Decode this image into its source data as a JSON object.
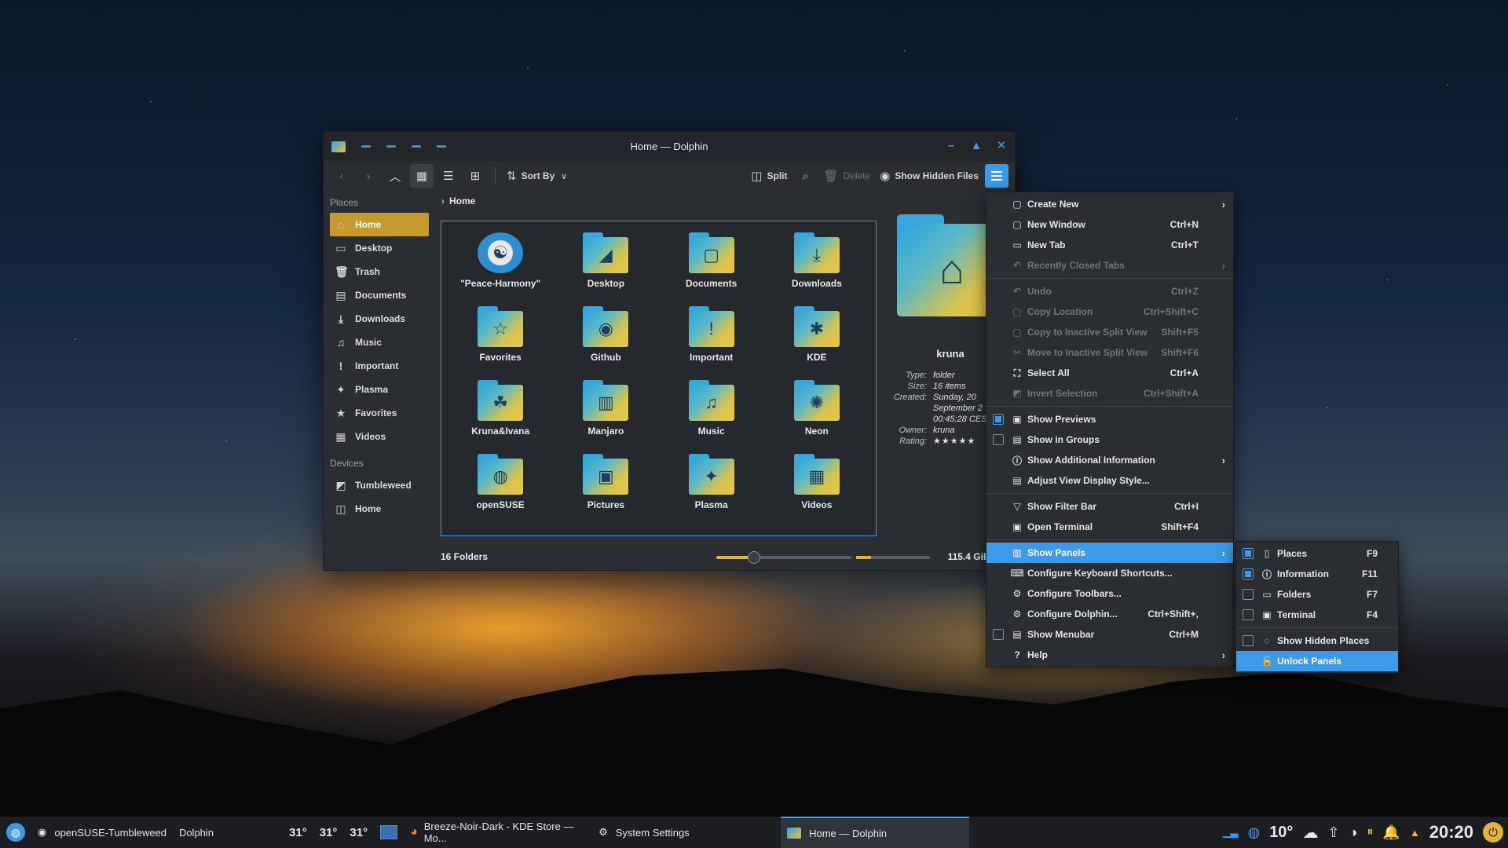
{
  "window": {
    "title": "Home — Dolphin",
    "min": "–",
    "max": "▲",
    "close": "✕"
  },
  "toolbar": {
    "sort_by": "Sort By",
    "split": "Split",
    "delete": "Delete",
    "show_hidden": "Show Hidden Files"
  },
  "sidebar": {
    "places_header": "Places",
    "places": [
      {
        "label": "Home",
        "icon": "home-icon",
        "glyph": "⌂"
      },
      {
        "label": "Desktop",
        "icon": "desktop-icon",
        "glyph": "▭"
      },
      {
        "label": "Trash",
        "icon": "trash-icon",
        "glyph": "🗑"
      },
      {
        "label": "Documents",
        "icon": "documents-icon",
        "glyph": "▤"
      },
      {
        "label": "Downloads",
        "icon": "downloads-icon",
        "glyph": "⤓"
      },
      {
        "label": "Music",
        "icon": "music-icon",
        "glyph": "♫"
      },
      {
        "label": "Important",
        "icon": "important-icon",
        "glyph": "!"
      },
      {
        "label": "Plasma",
        "icon": "plasma-icon",
        "glyph": "✦"
      },
      {
        "label": "Favorites",
        "icon": "star-icon",
        "glyph": "★"
      },
      {
        "label": "Videos",
        "icon": "videos-icon",
        "glyph": "▦"
      }
    ],
    "devices_header": "Devices",
    "devices": [
      {
        "label": "Tumbleweed",
        "icon": "drive-icon",
        "glyph": "◩"
      },
      {
        "label": "Home",
        "icon": "drive-icon",
        "glyph": "◫"
      }
    ]
  },
  "breadcrumb": "Home",
  "files": [
    {
      "name": "\"Peace-Harmony\"",
      "glyph": "☯"
    },
    {
      "name": "Desktop",
      "glyph": "◢"
    },
    {
      "name": "Documents",
      "glyph": "▢"
    },
    {
      "name": "Downloads",
      "glyph": "⤓"
    },
    {
      "name": "Favorites",
      "glyph": "☆"
    },
    {
      "name": "Github",
      "glyph": "◉"
    },
    {
      "name": "Important",
      "glyph": "!"
    },
    {
      "name": "KDE",
      "glyph": "✱"
    },
    {
      "name": "Kruna&Ivana",
      "glyph": "☘"
    },
    {
      "name": "Manjaro",
      "glyph": "▥"
    },
    {
      "name": "Music",
      "glyph": "♫"
    },
    {
      "name": "Neon",
      "glyph": "✺"
    },
    {
      "name": "openSUSE",
      "glyph": "◍"
    },
    {
      "name": "Pictures",
      "glyph": "▣"
    },
    {
      "name": "Plasma",
      "glyph": "✦"
    },
    {
      "name": "Videos",
      "glyph": "▦"
    }
  ],
  "status": {
    "count": "16 Folders",
    "free": "115.4 GiB free",
    "zoom_fraction": 0.28,
    "used_fraction": 0.2
  },
  "info": {
    "name": "kruna",
    "type_k": "Type:",
    "type_v": "folder",
    "size_k": "Size:",
    "size_v": "16 items",
    "created_k": "Created:",
    "created_v1": "Sunday, 20",
    "created_v2": "September 2",
    "created_v3": "00:45:28 CES",
    "owner_k": "Owner:",
    "owner_v": "kruna",
    "rating_k": "Rating:",
    "rating_v": "★★★★★"
  },
  "menu": [
    {
      "label": "Create New",
      "glyph": "▢",
      "arrow": "›"
    },
    {
      "label": "New Window",
      "glyph": "▢",
      "sc": "Ctrl+N"
    },
    {
      "label": "New Tab",
      "glyph": "▭",
      "sc": "Ctrl+T"
    },
    {
      "label": "Recently Closed Tabs",
      "glyph": "↶",
      "arrow": "›",
      "dis": true
    },
    {
      "sep": true
    },
    {
      "label": "Undo",
      "glyph": "↶",
      "sc": "Ctrl+Z",
      "dis": true
    },
    {
      "label": "Copy Location",
      "glyph": "▢",
      "sc": "Ctrl+Shift+C",
      "dis": true
    },
    {
      "label": "Copy to Inactive Split View",
      "glyph": "▢",
      "sc": "Shift+F5",
      "dis": true
    },
    {
      "label": "Move to Inactive Split View",
      "glyph": "✂",
      "sc": "Shift+F6",
      "dis": true
    },
    {
      "label": "Select All",
      "glyph": "⛶",
      "sc": "Ctrl+A"
    },
    {
      "label": "Invert Selection",
      "glyph": "◩",
      "sc": "Ctrl+Shift+A",
      "dis": true
    },
    {
      "sep": true
    },
    {
      "label": "Show Previews",
      "glyph": "▣",
      "check": true,
      "on": true
    },
    {
      "label": "Show in Groups",
      "glyph": "▤",
      "check": true
    },
    {
      "label": "Show Additional Information",
      "glyph": "ⓘ",
      "arrow": "›"
    },
    {
      "label": "Adjust View Display Style...",
      "glyph": "▤"
    },
    {
      "sep": true
    },
    {
      "label": "Show Filter Bar",
      "glyph": "▽",
      "sc": "Ctrl+I"
    },
    {
      "label": "Open Terminal",
      "glyph": "▣",
      "sc": "Shift+F4"
    },
    {
      "sep": true
    },
    {
      "label": "Show Panels",
      "glyph": "▥",
      "arrow": "›",
      "hl": true
    },
    {
      "label": "Configure Keyboard Shortcuts...",
      "glyph": "⌨"
    },
    {
      "label": "Configure Toolbars...",
      "glyph": "⚙"
    },
    {
      "label": "Configure Dolphin...",
      "glyph": "⚙",
      "sc": "Ctrl+Shift+,"
    },
    {
      "label": "Show Menubar",
      "glyph": "▤",
      "sc": "Ctrl+M",
      "check": true
    },
    {
      "label": "Help",
      "glyph": "?",
      "arrow": "›"
    }
  ],
  "submenu": [
    {
      "label": "Places",
      "glyph": "▯",
      "sc": "F9",
      "check": true,
      "on": true
    },
    {
      "label": "Information",
      "glyph": "ⓘ",
      "sc": "F11",
      "check": true,
      "on": true
    },
    {
      "label": "Folders",
      "glyph": "▭",
      "sc": "F7",
      "check": true
    },
    {
      "label": "Terminal",
      "glyph": "▣",
      "sc": "F4",
      "check": true
    },
    {
      "sep": true
    },
    {
      "label": "Show Hidden Places",
      "glyph": "◌",
      "check": true
    },
    {
      "label": "Unlock Panels",
      "glyph": "🔓",
      "hl": true
    }
  ],
  "taskbar": {
    "activity": "openSUSE-Tumbleweed",
    "app": "Dolphin",
    "temps": [
      "31°",
      "31°",
      "31°"
    ],
    "tasks": [
      "Breeze-Noir-Dark - KDE Store — Mo...",
      "System Settings",
      "Home — Dolphin"
    ],
    "weather": "10°",
    "clock": "20:20"
  }
}
